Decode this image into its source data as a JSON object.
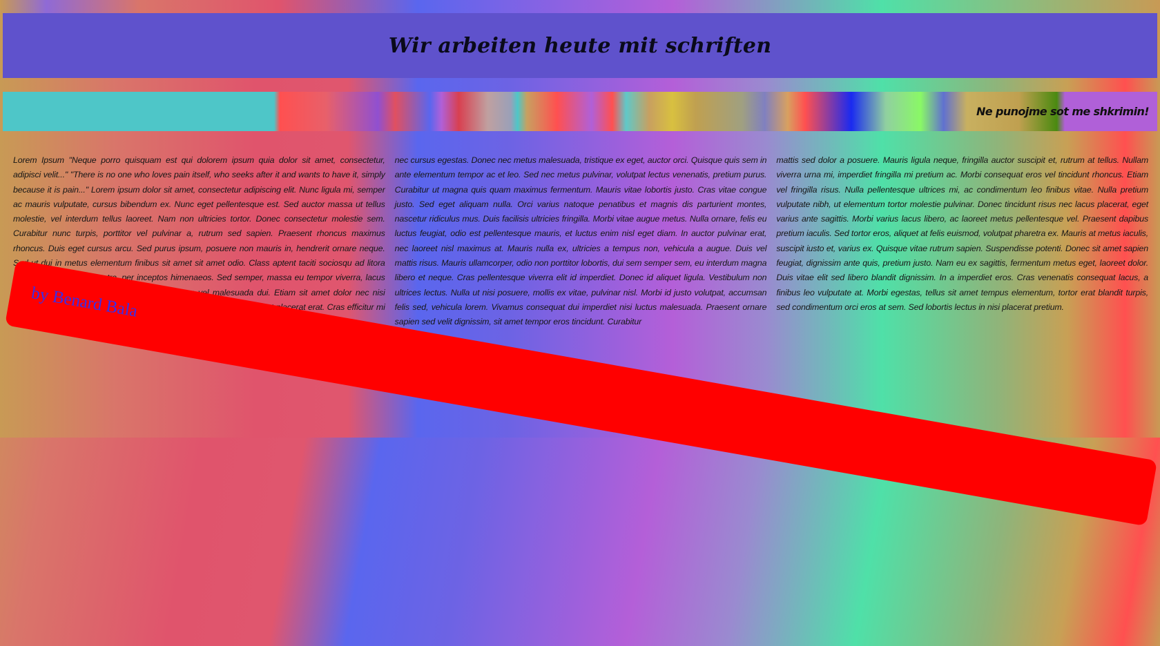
{
  "header": {
    "title": "Wir arbeiten heute mit schriften"
  },
  "stripe": {
    "text": "Ne punojme sot me shkrimin!"
  },
  "columns": [
    "Lorem Ipsum \"Neque porro quisquam est qui dolorem ipsum quia dolor sit amet, consectetur, adipisci velit...\" \"There is no one who loves pain itself, who seeks after it and wants to have it, simply because it is pain...\" Lorem ipsum dolor sit amet, consectetur adipiscing elit. Nunc ligula mi, semper ac mauris vulputate, cursus bibendum ex. Nunc eget pellentesque est. Sed auctor massa ut tellus molestie, vel interdum tellus laoreet. Nam non ultricies tortor. Donec consectetur molestie sem. Curabitur nunc turpis, porttitor vel pulvinar a, rutrum sed sapien. Praesent rhoncus maximus rhoncus. Duis eget cursus arcu. Sed purus ipsum, posuere non mauris in, hendrerit ornare neque. Sed ut dui in metus elementum finibus sit amet sit amet odio. Class aptent taciti sociosqu ad litora torquent per conubia nostra, per inceptos himenaeos. Sed semper, massa eu tempor viverra, lacus est congue nisi, eget commodo quam. Aliquam vel malesuada dui. Etiam sit amet dolor nec nisi porta maximus nec a magna. Donec consequat eleifend. Maecenas at placerat erat. Cras efficitur mi at urna tincidunt, at luctus justo aliquet. Curabitur",
    "nec cursus egestas. Donec nec metus malesuada, tristique ex eget, auctor orci. Quisque quis sem in ante elementum tempor ac et leo. Sed nec metus pulvinar, volutpat lectus venenatis, pretium purus. Curabitur ut magna quis quam maximus fermentum. Mauris vitae lobortis justo. Cras vitae congue justo. Sed eget aliquam nulla. Orci varius natoque penatibus et magnis dis parturient montes, nascetur ridiculus mus. Duis facilisis ultricies fringilla. Morbi vitae augue metus. Nulla ornare, felis eu luctus feugiat, odio est pellentesque mauris, et luctus enim nisl eget diam. In auctor pulvinar erat, nec laoreet nisl maximus at. Mauris nulla ex, ultricies a tempus non, vehicula a augue. Duis vel mattis risus. Mauris ullamcorper, odio non porttitor lobortis, dui sem semper sem, eu interdum magna libero et neque. Cras pellentesque viverra elit id imperdiet. Donec id aliquet ligula. Vestibulum non ultrices lectus. Nulla ut nisi posuere, mollis ex vitae, pulvinar nisl. Morbi id justo volutpat, accumsan felis sed, vehicula lorem. Vivamus consequat dui imperdiet nisi luctus malesuada. Praesent ornare sapien sed velit dignissim, sit amet tempor eros tincidunt. Curabitur",
    "mattis sed dolor a posuere. Mauris ligula neque, fringilla auctor suscipit et, rutrum at tellus. Nullam viverra urna mi, imperdiet fringilla mi pretium ac. Morbi consequat eros vel tincidunt rhoncus. Etiam vel fringilla risus. Nulla pellentesque ultrices mi, ac condimentum leo finibus vitae. Nulla pretium vulputate nibh, ut elementum tortor molestie pulvinar. Donec tincidunt risus nec lacus placerat, eget varius ante sagittis. Morbi varius lacus libero, ac laoreet metus pellentesque vel. Praesent dapibus pretium iaculis. Sed tortor eros, aliquet at felis euismod, volutpat pharetra ex. Mauris at metus iaculis, suscipit iusto et, varius ex. Quisque vitae rutrum sapien. Suspendisse potenti. Donec sit amet sapien feugiat, dignissim ante quis, pretium justo. Nam eu ex sagittis, fermentum metus eget, laoreet dolor. Duis vitae elit sed libero blandit dignissim. In a imperdiet eros. Cras venenatis consequat lacus, a finibus leo vulputate at. Morbi egestas, tellus sit amet tempus elementum, tortor erat blandit turpis, sed condimentum orci eros at sem. Sed lobortis lectus in nisi placerat pretium."
  ],
  "ribbon": {
    "text": "by Benard Bala",
    "color": "#ff0000",
    "text_color": "#3a2ee8"
  }
}
